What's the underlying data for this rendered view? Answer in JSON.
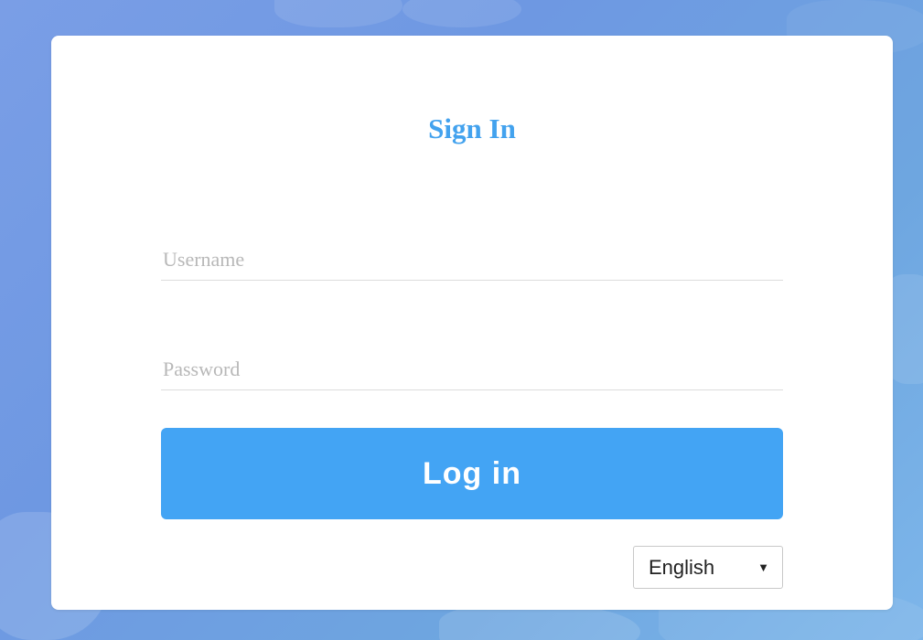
{
  "login": {
    "title": "Sign In",
    "username_placeholder": "Username",
    "password_placeholder": "Password",
    "login_button": "Log in",
    "language": {
      "selected": "English",
      "icon": "triangle-down-icon"
    }
  },
  "colors": {
    "accent": "#43a4f4",
    "title": "#43a2ee",
    "background": "#6e98e2"
  }
}
